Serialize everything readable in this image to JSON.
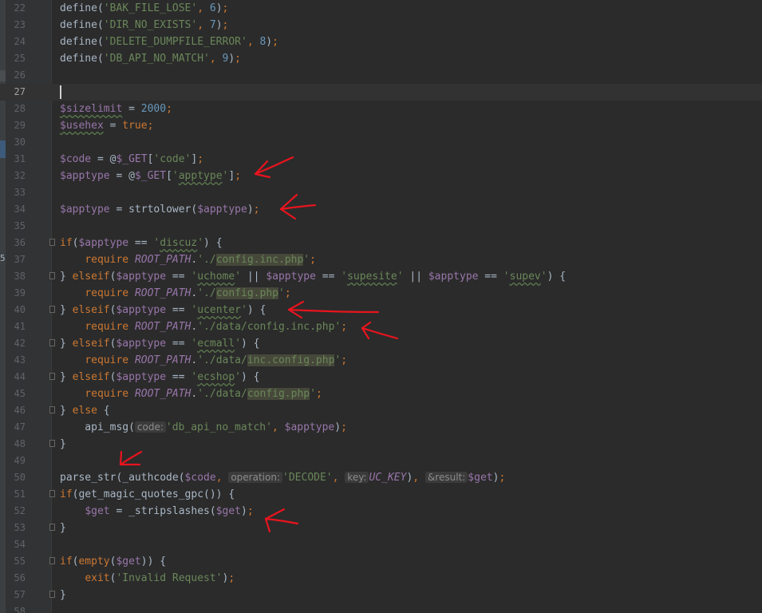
{
  "editor": {
    "current_line": "27",
    "side_digit": "5",
    "lines": [
      {
        "num": "22",
        "tokens": [
          [
            "t-p",
            "define("
          ],
          [
            "t-str",
            "'BAK_FILE_LOSE'"
          ],
          [
            "t-kw",
            ", "
          ],
          [
            "t-num",
            "6"
          ],
          [
            "t-p",
            ")"
          ],
          [
            "t-kw",
            ";"
          ]
        ]
      },
      {
        "num": "23",
        "tokens": [
          [
            "t-p",
            "define("
          ],
          [
            "t-str",
            "'DIR_NO_EXISTS'"
          ],
          [
            "t-kw",
            ", "
          ],
          [
            "t-num",
            "7"
          ],
          [
            "t-p",
            ")"
          ],
          [
            "t-kw",
            ";"
          ]
        ]
      },
      {
        "num": "24",
        "tokens": [
          [
            "t-p",
            "define("
          ],
          [
            "t-str",
            "'DELETE_DUMPFILE_ERROR'"
          ],
          [
            "t-kw",
            ", "
          ],
          [
            "t-num",
            "8"
          ],
          [
            "t-p",
            ")"
          ],
          [
            "t-kw",
            ";"
          ]
        ]
      },
      {
        "num": "25",
        "tokens": [
          [
            "t-p",
            "define("
          ],
          [
            "t-str",
            "'DB_API_NO_MATCH'"
          ],
          [
            "t-kw",
            ", "
          ],
          [
            "t-num",
            "9"
          ],
          [
            "t-p",
            ")"
          ],
          [
            "t-kw",
            ";"
          ]
        ]
      },
      {
        "num": "26",
        "tokens": []
      },
      {
        "num": "27",
        "tokens": []
      },
      {
        "num": "28",
        "tokens": [
          [
            "t-var wavy",
            "$sizelimit"
          ],
          [
            "t-p",
            " = "
          ],
          [
            "t-num",
            "2000"
          ],
          [
            "t-kw",
            ";"
          ]
        ]
      },
      {
        "num": "29",
        "tokens": [
          [
            "t-var wavy",
            "$usehex"
          ],
          [
            "t-p",
            " = "
          ],
          [
            "t-kw",
            "true"
          ],
          [
            "t-kw",
            ";"
          ]
        ]
      },
      {
        "num": "30",
        "tokens": []
      },
      {
        "num": "31",
        "tokens": [
          [
            "t-var",
            "$code"
          ],
          [
            "t-p",
            " = @"
          ],
          [
            "t-var",
            "$_GET"
          ],
          [
            "t-p",
            "["
          ],
          [
            "t-str",
            "'code'"
          ],
          [
            "t-p",
            "]"
          ],
          [
            "t-kw",
            ";"
          ]
        ]
      },
      {
        "num": "32",
        "tokens": [
          [
            "t-var",
            "$apptype"
          ],
          [
            "t-p",
            " = @"
          ],
          [
            "t-var",
            "$_GET"
          ],
          [
            "t-p",
            "["
          ],
          [
            "t-str",
            "'"
          ],
          [
            "t-str wavy",
            "apptype"
          ],
          [
            "t-str",
            "'"
          ],
          [
            "t-p",
            "]"
          ],
          [
            "t-kw",
            ";"
          ]
        ]
      },
      {
        "num": "33",
        "tokens": []
      },
      {
        "num": "34",
        "tokens": [
          [
            "t-var",
            "$apptype"
          ],
          [
            "t-p",
            " = strtolower("
          ],
          [
            "t-var",
            "$apptype"
          ],
          [
            "t-p",
            ")"
          ],
          [
            "t-kw",
            ";"
          ]
        ]
      },
      {
        "num": "35",
        "tokens": []
      },
      {
        "num": "36",
        "fold": true,
        "tokens": [
          [
            "t-kw",
            "if"
          ],
          [
            "t-p",
            "("
          ],
          [
            "t-var",
            "$apptype"
          ],
          [
            "t-p",
            " == "
          ],
          [
            "t-str",
            "'"
          ],
          [
            "t-str wavy",
            "discuz"
          ],
          [
            "t-str",
            "'"
          ],
          [
            "t-p",
            ") {"
          ]
        ]
      },
      {
        "num": "37",
        "tokens": [
          [
            "t-p",
            "    "
          ],
          [
            "t-kw",
            "require "
          ],
          [
            "t-const",
            "ROOT_PATH"
          ],
          [
            "t-p",
            "."
          ],
          [
            "t-str",
            "'./"
          ],
          [
            "t-str t-hl",
            "config.inc.php"
          ],
          [
            "t-str",
            "'"
          ],
          [
            "t-kw",
            ";"
          ]
        ]
      },
      {
        "num": "38",
        "fold": true,
        "tokens": [
          [
            "t-p",
            "} "
          ],
          [
            "t-kw",
            "elseif"
          ],
          [
            "t-p",
            "("
          ],
          [
            "t-var",
            "$apptype"
          ],
          [
            "t-p",
            " == "
          ],
          [
            "t-str",
            "'"
          ],
          [
            "t-str wavy",
            "uchome"
          ],
          [
            "t-str",
            "'"
          ],
          [
            "t-p",
            " || "
          ],
          [
            "t-var",
            "$apptype"
          ],
          [
            "t-p",
            " == "
          ],
          [
            "t-str",
            "'"
          ],
          [
            "t-str wavy",
            "supesite"
          ],
          [
            "t-str",
            "'"
          ],
          [
            "t-p",
            " || "
          ],
          [
            "t-var",
            "$apptype"
          ],
          [
            "t-p",
            " == "
          ],
          [
            "t-str",
            "'"
          ],
          [
            "t-str wavy",
            "supev"
          ],
          [
            "t-str",
            "'"
          ],
          [
            "t-p",
            ") {"
          ]
        ]
      },
      {
        "num": "39",
        "tokens": [
          [
            "t-p",
            "    "
          ],
          [
            "t-kw",
            "require "
          ],
          [
            "t-const",
            "ROOT_PATH"
          ],
          [
            "t-p",
            "."
          ],
          [
            "t-str",
            "'./"
          ],
          [
            "t-str t-hl",
            "config.php"
          ],
          [
            "t-str",
            "'"
          ],
          [
            "t-kw",
            ";"
          ]
        ]
      },
      {
        "num": "40",
        "fold": true,
        "tokens": [
          [
            "t-p",
            "} "
          ],
          [
            "t-kw",
            "elseif"
          ],
          [
            "t-p",
            "("
          ],
          [
            "t-var",
            "$apptype"
          ],
          [
            "t-p",
            " == "
          ],
          [
            "t-str",
            "'"
          ],
          [
            "t-str wavy",
            "ucenter"
          ],
          [
            "t-str",
            "'"
          ],
          [
            "t-p",
            ") {"
          ]
        ]
      },
      {
        "num": "41",
        "tokens": [
          [
            "t-p",
            "    "
          ],
          [
            "t-kw",
            "require "
          ],
          [
            "t-const",
            "ROOT_PATH"
          ],
          [
            "t-p",
            "."
          ],
          [
            "t-str",
            "'./data/config.inc.php'"
          ],
          [
            "t-kw",
            ";"
          ]
        ]
      },
      {
        "num": "42",
        "fold": true,
        "tokens": [
          [
            "t-p",
            "} "
          ],
          [
            "t-kw",
            "elseif"
          ],
          [
            "t-p",
            "("
          ],
          [
            "t-var",
            "$apptype"
          ],
          [
            "t-p",
            " == "
          ],
          [
            "t-str",
            "'"
          ],
          [
            "t-str wavy",
            "ecmall"
          ],
          [
            "t-str",
            "'"
          ],
          [
            "t-p",
            ") {"
          ]
        ]
      },
      {
        "num": "43",
        "tokens": [
          [
            "t-p",
            "    "
          ],
          [
            "t-kw",
            "require "
          ],
          [
            "t-const",
            "ROOT_PATH"
          ],
          [
            "t-p",
            "."
          ],
          [
            "t-str",
            "'./data/"
          ],
          [
            "t-str t-hl",
            "inc.config.php"
          ],
          [
            "t-str",
            "'"
          ],
          [
            "t-kw",
            ";"
          ]
        ]
      },
      {
        "num": "44",
        "fold": true,
        "tokens": [
          [
            "t-p",
            "} "
          ],
          [
            "t-kw",
            "elseif"
          ],
          [
            "t-p",
            "("
          ],
          [
            "t-var",
            "$apptype"
          ],
          [
            "t-p",
            " == "
          ],
          [
            "t-str",
            "'"
          ],
          [
            "t-str wavy",
            "ecshop"
          ],
          [
            "t-str",
            "'"
          ],
          [
            "t-p",
            ") {"
          ]
        ]
      },
      {
        "num": "45",
        "tokens": [
          [
            "t-p",
            "    "
          ],
          [
            "t-kw",
            "require "
          ],
          [
            "t-const",
            "ROOT_PATH"
          ],
          [
            "t-p",
            "."
          ],
          [
            "t-str",
            "'./data/"
          ],
          [
            "t-str t-hl",
            "config.php"
          ],
          [
            "t-str",
            "'"
          ],
          [
            "t-kw",
            ";"
          ]
        ]
      },
      {
        "num": "46",
        "fold": true,
        "tokens": [
          [
            "t-p",
            "} "
          ],
          [
            "t-kw",
            "else"
          ],
          [
            "t-p",
            " {"
          ]
        ]
      },
      {
        "num": "47",
        "tokens": [
          [
            "t-p",
            "    api_msg("
          ],
          [
            "hint",
            "code:"
          ],
          [
            "t-str",
            "'db_api_no_match'"
          ],
          [
            "t-kw",
            ", "
          ],
          [
            "t-var",
            "$apptype"
          ],
          [
            "t-p",
            ")"
          ],
          [
            "t-kw",
            ";"
          ]
        ]
      },
      {
        "num": "48",
        "fold": true,
        "tokens": [
          [
            "t-p",
            "}"
          ]
        ]
      },
      {
        "num": "49",
        "tokens": []
      },
      {
        "num": "50",
        "tokens": [
          [
            "t-p",
            "parse_str(_authcode("
          ],
          [
            "t-var",
            "$code"
          ],
          [
            "t-kw",
            ", "
          ],
          [
            "hint",
            "operation:"
          ],
          [
            "t-str",
            "'DECODE'"
          ],
          [
            "t-kw",
            ", "
          ],
          [
            "hint",
            "key:"
          ],
          [
            "t-const",
            "UC_KEY"
          ],
          [
            "t-p",
            ")"
          ],
          [
            "t-kw",
            ", "
          ],
          [
            "hint",
            "&result:"
          ],
          [
            "t-var",
            "$get"
          ],
          [
            "t-p",
            ")"
          ],
          [
            "t-kw",
            ";"
          ]
        ]
      },
      {
        "num": "51",
        "fold": true,
        "tokens": [
          [
            "t-kw",
            "if"
          ],
          [
            "t-p",
            "(get_magic_quotes_gpc()) {"
          ]
        ]
      },
      {
        "num": "52",
        "tokens": [
          [
            "t-p",
            "    "
          ],
          [
            "t-var",
            "$get"
          ],
          [
            "t-p",
            " = _stripslashes("
          ],
          [
            "t-var",
            "$get"
          ],
          [
            "t-p",
            ")"
          ],
          [
            "t-kw",
            ";"
          ]
        ]
      },
      {
        "num": "53",
        "fold": true,
        "tokens": [
          [
            "t-p",
            "}"
          ]
        ]
      },
      {
        "num": "54",
        "tokens": []
      },
      {
        "num": "55",
        "fold": true,
        "tokens": [
          [
            "t-kw",
            "if"
          ],
          [
            "t-p",
            "("
          ],
          [
            "t-kw",
            "empty"
          ],
          [
            "t-p",
            "("
          ],
          [
            "t-var",
            "$get"
          ],
          [
            "t-p",
            ")) {"
          ]
        ]
      },
      {
        "num": "56",
        "tokens": [
          [
            "t-p",
            "    "
          ],
          [
            "t-kw",
            "exit"
          ],
          [
            "t-p",
            "("
          ],
          [
            "t-str",
            "'Invalid Request'"
          ],
          [
            "t-p",
            ")"
          ],
          [
            "t-kw",
            ";"
          ]
        ]
      },
      {
        "num": "57",
        "fold": true,
        "tokens": [
          [
            "t-p",
            "}"
          ]
        ]
      },
      {
        "num": "58",
        "tokens": []
      }
    ]
  },
  "annotation_color": "#e8141e"
}
